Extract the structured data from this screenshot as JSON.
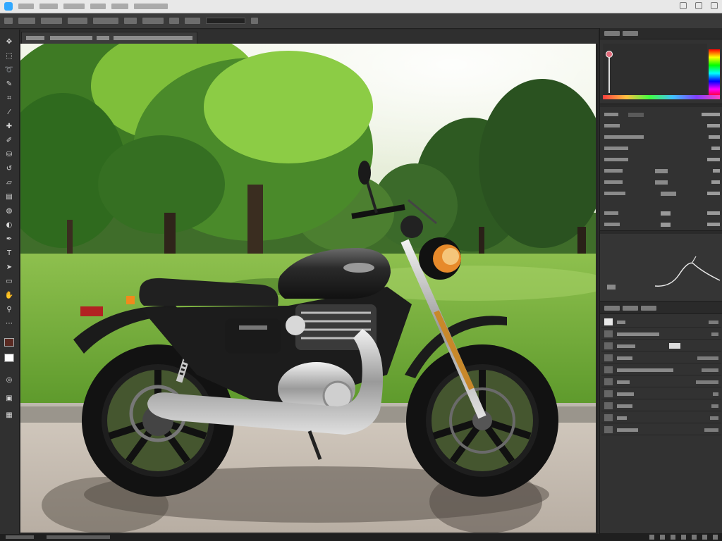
{
  "app": {
    "title": "",
    "menus": [
      "",
      "",
      "",
      "",
      "",
      ""
    ]
  },
  "options_bar": {
    "items": [
      "",
      "",
      "",
      "",
      "",
      "",
      "",
      ""
    ]
  },
  "document_tab": {
    "label": ""
  },
  "toolbar": {
    "tools": [
      "move-icon",
      "marquee-icon",
      "lasso-icon",
      "quick-select-icon",
      "crop-icon",
      "eyedropper-icon",
      "healing-icon",
      "brush-icon",
      "clone-stamp-icon",
      "history-brush-icon",
      "eraser-icon",
      "gradient-icon",
      "blur-icon",
      "dodge-icon",
      "pen-icon",
      "type-icon",
      "path-select-icon",
      "shape-icon",
      "hand-icon",
      "zoom-icon",
      "edit-toolbar-icon",
      "foreground-color",
      "background-color",
      "quick-mask-icon",
      "screen-mode-icon"
    ],
    "foreground_color": "#5a2a22",
    "background_color": "#ffffff"
  },
  "color_panel": {
    "tabs": [
      "",
      ""
    ],
    "spectrum_colors": [
      "#ff0000",
      "#ffff00",
      "#00ff00",
      "#00ffff",
      "#0000ff",
      "#ff00ff",
      "#ff0000"
    ]
  },
  "properties_panel": {
    "rows": [
      {
        "label": "",
        "value": ""
      },
      {
        "label": "",
        "value": ""
      },
      {
        "label": "",
        "value": ""
      },
      {
        "label": "",
        "value": ""
      },
      {
        "label": "",
        "value": ""
      },
      {
        "label": "",
        "value": ""
      },
      {
        "label": "",
        "value": ""
      },
      {
        "label": "",
        "value": ""
      },
      {
        "label": "",
        "value": ""
      },
      {
        "label": "",
        "value": ""
      }
    ]
  },
  "curves_panel": {
    "label": ""
  },
  "layers_panel": {
    "tabs": [
      "",
      "",
      ""
    ],
    "layers": [
      {
        "name": "",
        "value": ""
      },
      {
        "name": "",
        "value": ""
      },
      {
        "name": "",
        "value": ""
      },
      {
        "name": "",
        "value": ""
      },
      {
        "name": "",
        "value": ""
      },
      {
        "name": "",
        "value": ""
      },
      {
        "name": "",
        "value": ""
      },
      {
        "name": "",
        "value": ""
      },
      {
        "name": "",
        "value": ""
      },
      {
        "name": "",
        "value": ""
      }
    ]
  },
  "status_bar": {
    "zoom": "",
    "doc_info": ""
  },
  "colors": {
    "accent": "#31a8ff",
    "panel": "#323232",
    "background": "#2b2b2b"
  }
}
